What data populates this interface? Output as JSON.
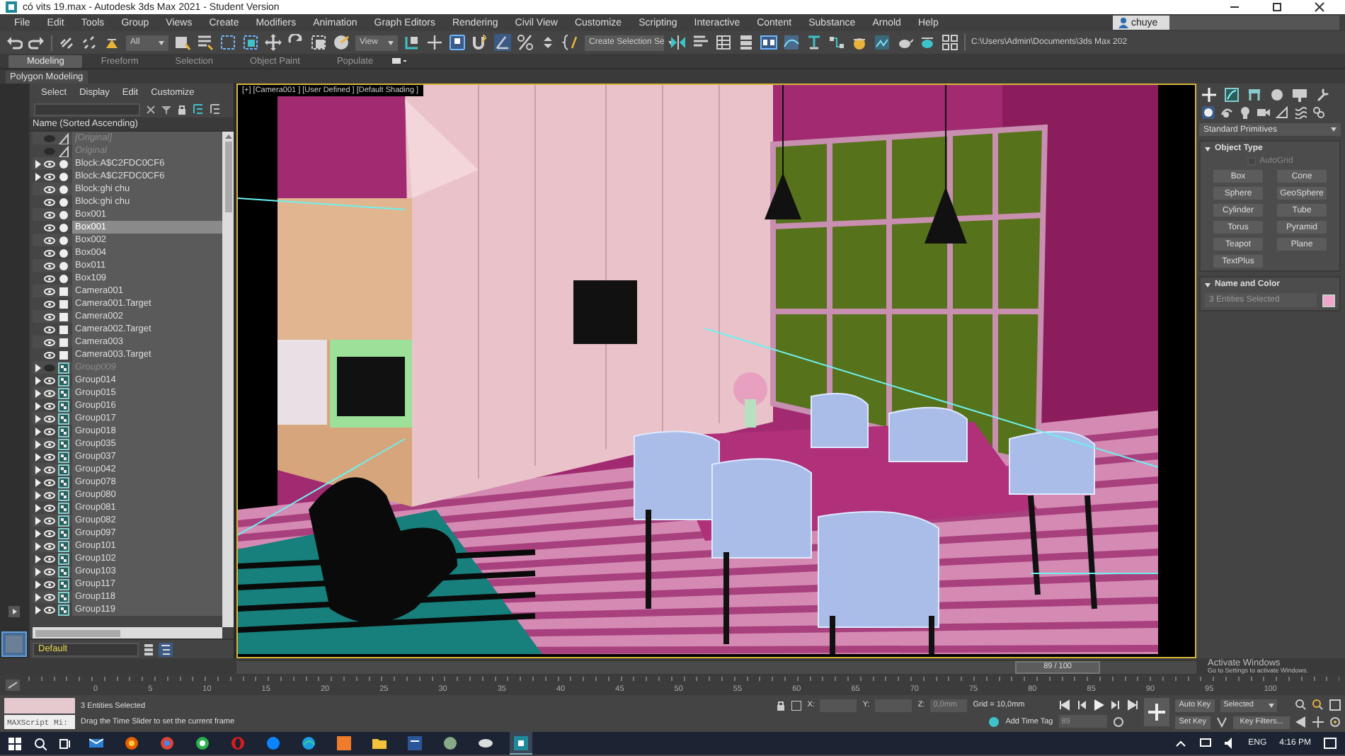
{
  "window": {
    "title": "có vits 19.max - Autodesk 3ds Max 2021 - Student Version"
  },
  "menu": [
    "File",
    "Edit",
    "Tools",
    "Group",
    "Views",
    "Create",
    "Modifiers",
    "Animation",
    "Graph Editors",
    "Rendering",
    "Civil View",
    "Customize",
    "Scripting",
    "Interactive",
    "Content",
    "Substance",
    "Arnold",
    "Help"
  ],
  "toolbar": {
    "selection_filter": "All",
    "reference_coord": "View",
    "selection_set": "Create Selection Se",
    "project_path": "C:\\Users\\Admin\\Documents\\3ds Max 202",
    "user": "chuye"
  },
  "ribbon": {
    "tabs": [
      {
        "label": "Modeling",
        "selected": true
      },
      {
        "label": "Freeform",
        "selected": false
      },
      {
        "label": "Selection",
        "selected": false
      },
      {
        "label": "Object Paint",
        "selected": false
      },
      {
        "label": "Populate",
        "selected": false
      }
    ],
    "panel": "Polygon Modeling"
  },
  "scene_explorer": {
    "tabs": [
      "Select",
      "Display",
      "Edit",
      "Customize"
    ],
    "header": "Name (Sorted Ascending)",
    "layer": "Default",
    "items": [
      {
        "name": "[Original]",
        "kind": "helper",
        "hidden": true,
        "expandable": false,
        "selected": false
      },
      {
        "name": "Original",
        "kind": "helper",
        "hidden": true,
        "expandable": false,
        "selected": false
      },
      {
        "name": "Block:A$C2FDC0CF6",
        "kind": "geometry",
        "hidden": false,
        "expandable": true,
        "selected": false
      },
      {
        "name": "Block:A$C2FDC0CF6",
        "kind": "geometry",
        "hidden": false,
        "expandable": true,
        "selected": false
      },
      {
        "name": "Block:ghi chu",
        "kind": "geometry",
        "hidden": false,
        "expandable": false,
        "selected": false
      },
      {
        "name": "Block:ghi chu",
        "kind": "geometry",
        "hidden": false,
        "expandable": false,
        "selected": false
      },
      {
        "name": "Box001",
        "kind": "geometry",
        "hidden": false,
        "expandable": false,
        "selected": false
      },
      {
        "name": "Box001",
        "kind": "geometry",
        "hidden": false,
        "expandable": false,
        "selected": true
      },
      {
        "name": "Box002",
        "kind": "geometry",
        "hidden": false,
        "expandable": false,
        "selected": false
      },
      {
        "name": "Box004",
        "kind": "geometry",
        "hidden": false,
        "expandable": false,
        "selected": false
      },
      {
        "name": "Box011",
        "kind": "geometry",
        "hidden": false,
        "expandable": false,
        "selected": false
      },
      {
        "name": "Box109",
        "kind": "geometry",
        "hidden": false,
        "expandable": false,
        "selected": false
      },
      {
        "name": "Camera001",
        "kind": "camera",
        "hidden": false,
        "expandable": false,
        "selected": false
      },
      {
        "name": "Camera001.Target",
        "kind": "camera",
        "hidden": false,
        "expandable": false,
        "selected": false
      },
      {
        "name": "Camera002",
        "kind": "camera",
        "hidden": false,
        "expandable": false,
        "selected": false
      },
      {
        "name": "Camera002.Target",
        "kind": "camera",
        "hidden": false,
        "expandable": false,
        "selected": false
      },
      {
        "name": "Camera003",
        "kind": "camera",
        "hidden": false,
        "expandable": false,
        "selected": false
      },
      {
        "name": "Camera003.Target",
        "kind": "camera",
        "hidden": false,
        "expandable": false,
        "selected": false
      },
      {
        "name": "Group009",
        "kind": "group",
        "hidden": true,
        "expandable": true,
        "selected": false
      },
      {
        "name": "Group014",
        "kind": "group",
        "hidden": false,
        "expandable": true,
        "selected": false
      },
      {
        "name": "Group015",
        "kind": "group",
        "hidden": false,
        "expandable": true,
        "selected": false
      },
      {
        "name": "Group016",
        "kind": "group",
        "hidden": false,
        "expandable": true,
        "selected": false
      },
      {
        "name": "Group017",
        "kind": "group",
        "hidden": false,
        "expandable": true,
        "selected": false
      },
      {
        "name": "Group018",
        "kind": "group",
        "hidden": false,
        "expandable": true,
        "selected": false
      },
      {
        "name": "Group035",
        "kind": "group",
        "hidden": false,
        "expandable": true,
        "selected": false
      },
      {
        "name": "Group037",
        "kind": "group",
        "hidden": false,
        "expandable": true,
        "selected": false
      },
      {
        "name": "Group042",
        "kind": "group",
        "hidden": false,
        "expandable": true,
        "selected": false
      },
      {
        "name": "Group078",
        "kind": "group",
        "hidden": false,
        "expandable": true,
        "selected": false
      },
      {
        "name": "Group080",
        "kind": "group",
        "hidden": false,
        "expandable": true,
        "selected": false
      },
      {
        "name": "Group081",
        "kind": "group",
        "hidden": false,
        "expandable": true,
        "selected": false
      },
      {
        "name": "Group082",
        "kind": "group",
        "hidden": false,
        "expandable": true,
        "selected": false
      },
      {
        "name": "Group097",
        "kind": "group",
        "hidden": false,
        "expandable": true,
        "selected": false
      },
      {
        "name": "Group101",
        "kind": "group",
        "hidden": false,
        "expandable": true,
        "selected": false
      },
      {
        "name": "Group102",
        "kind": "group",
        "hidden": false,
        "expandable": true,
        "selected": false
      },
      {
        "name": "Group103",
        "kind": "group",
        "hidden": false,
        "expandable": true,
        "selected": false
      },
      {
        "name": "Group117",
        "kind": "group",
        "hidden": false,
        "expandable": true,
        "selected": false
      },
      {
        "name": "Group118",
        "kind": "group",
        "hidden": false,
        "expandable": true,
        "selected": false
      },
      {
        "name": "Group119",
        "kind": "group",
        "hidden": false,
        "expandable": true,
        "selected": false
      }
    ]
  },
  "viewport": {
    "label": "[+] [Camera001 ] [User Defined ] [Default Shading ]"
  },
  "command_panel": {
    "category": "Standard Primitives",
    "object_type": {
      "title": "Object Type",
      "autogrid": {
        "label": "AutoGrid",
        "checked": false,
        "disabled": true
      },
      "buttons": [
        "Box",
        "Cone",
        "Sphere",
        "GeoSphere",
        "Cylinder",
        "Tube",
        "Torus",
        "Pyramid",
        "Teapot",
        "Plane",
        "TextPlus"
      ]
    },
    "name_and_color": {
      "title": "Name and Color",
      "name": "3 Entities Selected",
      "color": "#f0a6cc"
    }
  },
  "time_slider": {
    "label": "89 / 100",
    "level": 0.89
  },
  "ruler": [
    "0",
    "5",
    "10",
    "15",
    "20",
    "25",
    "30",
    "35",
    "40",
    "45",
    "50",
    "55",
    "60",
    "65",
    "70",
    "75",
    "80",
    "85",
    "90",
    "95",
    "100"
  ],
  "status": {
    "listener": "MAXScript Mi:",
    "selection": "3 Entities Selected",
    "prompt": "Drag the Time Slider to set the current frame",
    "x_label": "X:",
    "y_label": "Y:",
    "z_label": "Z:",
    "z_value": "0,0mm",
    "grid": "Grid = 10,0mm",
    "time_tag": "Add Time Tag",
    "frame": "89",
    "auto_key": "Auto Key",
    "key_mode": "Selected",
    "set_key": "Set Key",
    "key_filters": "Key Filters..."
  },
  "activation": {
    "title": "Activate Windows",
    "text": "Go to Settings to activate Windows."
  },
  "taskbar": {
    "language": "ENG",
    "time": "4:16 PM"
  }
}
